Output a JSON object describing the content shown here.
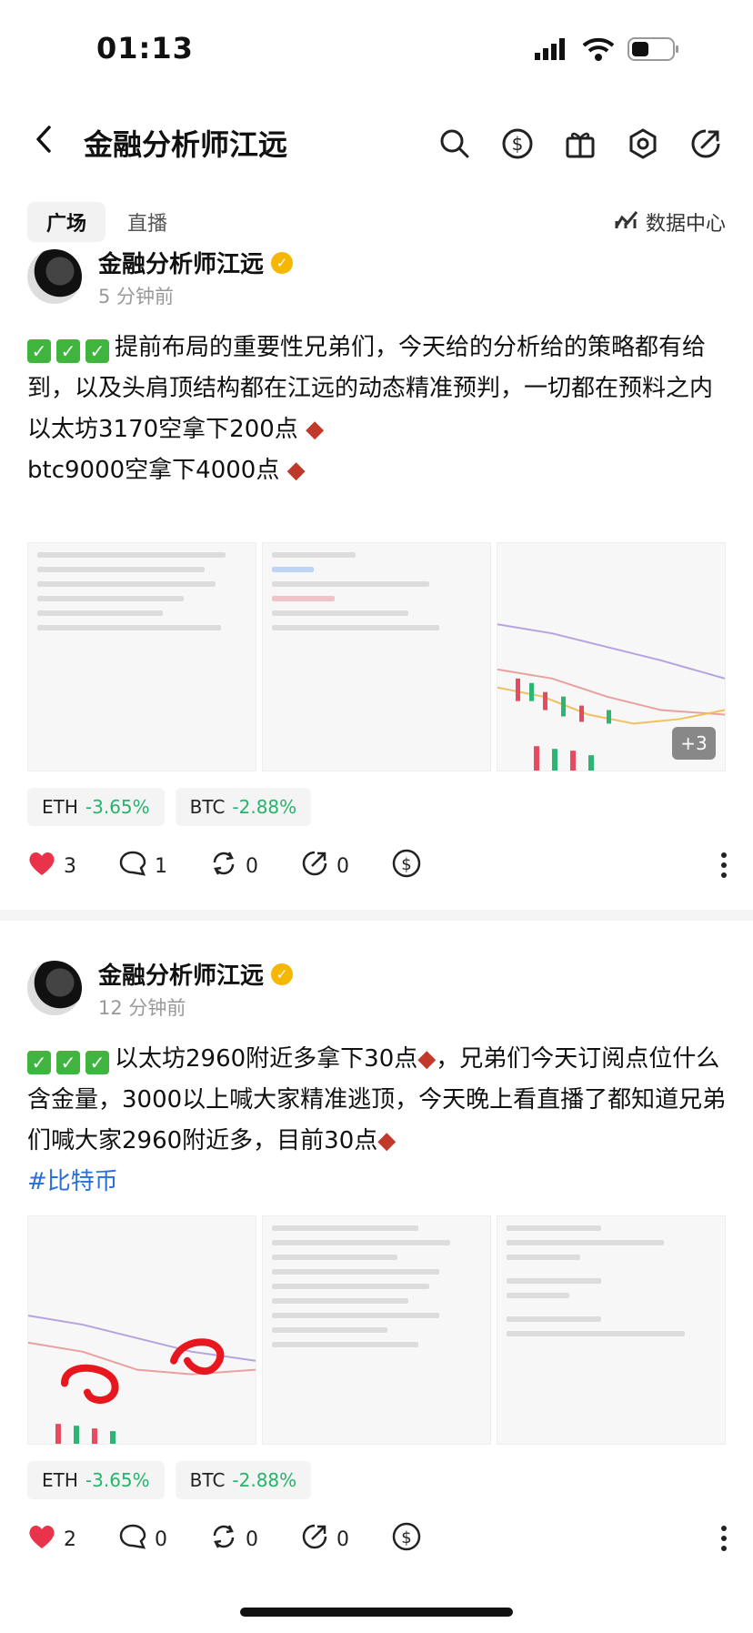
{
  "status_bar": {
    "time": "01:13"
  },
  "header": {
    "title": "金融分析师江远"
  },
  "tabs": {
    "active": "广场",
    "other": "直播",
    "data_center": "数据中心"
  },
  "posts": [
    {
      "author": "金融分析师江远",
      "time": "5 分钟前",
      "text_line1": "提前布局的重要性兄弟们，今天给的分析给的策略都有给到，以及头肩顶结构都在江远的动态精准预判，一切都在预料之内",
      "text_line2": "以太坊3170空拿下200点",
      "text_line3": "btc9000空拿下4000点",
      "more_images": "+3",
      "tickers": [
        {
          "symbol": "ETH",
          "change": "-3.65%"
        },
        {
          "symbol": "BTC",
          "change": "-2.88%"
        }
      ],
      "likes": "3",
      "comments": "1",
      "reposts": "0",
      "shares": "0"
    },
    {
      "author": "金融分析师江远",
      "time": "12 分钟前",
      "text_line1": "以太坊2960附近多拿下30点",
      "text_line2": "，兄弟们今天订阅点位什么含金量，3000以上喊大家精准逃顶，今天晚上看直播了都知道兄弟们喊大家2960附近多，目前30点",
      "hashtag": "#比特币",
      "tickers": [
        {
          "symbol": "ETH",
          "change": "-3.65%"
        },
        {
          "symbol": "BTC",
          "change": "-2.88%"
        }
      ],
      "likes": "2",
      "comments": "0",
      "reposts": "0",
      "shares": "0"
    }
  ],
  "colors": {
    "accent_green": "#27b36b",
    "like_red": "#e8334a",
    "hashtag_blue": "#2a6fd6",
    "verified": "#f5b700"
  }
}
